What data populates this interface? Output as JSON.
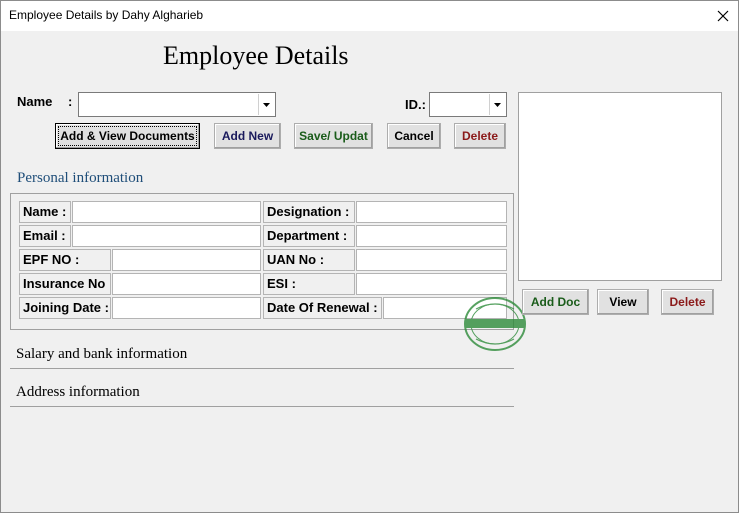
{
  "window": {
    "title": "Employee Details by Dahy Algharieb"
  },
  "heading": "Employee Details",
  "search": {
    "name_label": "Name",
    "name_colon": ":",
    "name_value": "",
    "id_label": "ID.:",
    "id_value": ""
  },
  "actions": {
    "add_view_documents": "Add & View Documents",
    "add_new": "Add New",
    "save_update": "Save/ Updat",
    "cancel": "Cancel",
    "delete": "Delete"
  },
  "personal": {
    "title": "Personal information",
    "fields": {
      "name": "Name :",
      "email": "Email :",
      "epf_no": "EPF NO :",
      "insurance_no": "Insurance No :",
      "joining_date": "Joining Date  :",
      "designation": "Designation :",
      "department": "Department :",
      "uan_no": "UAN No :",
      "esi": " ESI :",
      "date_of_renewal": "Date Of Renewal :"
    }
  },
  "sections": {
    "salary_bank": "Salary and bank information",
    "address": "Address information"
  },
  "documents": {
    "add_doc": "Add Doc",
    "view": "View",
    "delete": "Delete"
  },
  "colors": {
    "save_text": "#1a5c1a",
    "delete_text": "#8b1a1a",
    "add_new_text": "#1a1a5c",
    "add_doc_text": "#1a5c1a",
    "section_title": "#1f4e79",
    "stamp": "#2e8b3a"
  },
  "icons": {
    "close": "close-icon",
    "dropdown": "chevron-down-icon",
    "stamp": "watermark-stamp"
  }
}
